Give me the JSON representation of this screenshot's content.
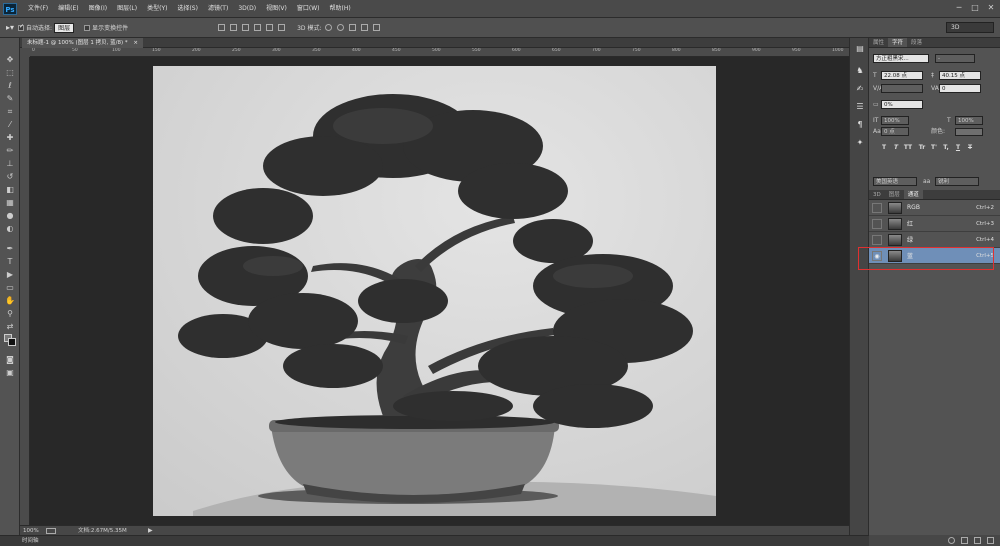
{
  "app": {
    "logo": "Ps",
    "workspace": "3D"
  },
  "menu": [
    "文件(F)",
    "编辑(E)",
    "图像(I)",
    "图层(L)",
    "类型(Y)",
    "选择(S)",
    "滤镜(T)",
    "3D(D)",
    "视图(V)",
    "窗口(W)",
    "帮助(H)"
  ],
  "window_controls": [
    "─",
    "□",
    "✕"
  ],
  "options": {
    "auto_select_label": "自动选择:",
    "auto_select_value": "图层",
    "show_transform_label": "显示变换控件",
    "mode_label": "3D 模式:"
  },
  "document": {
    "tab_title": "未标题-1 @ 100% (图层 1 拷贝, 蓝/8) *",
    "tab_close": "×",
    "ruler_ticks": [
      "0",
      "50",
      "100",
      "150",
      "200",
      "250",
      "300",
      "350",
      "400",
      "450",
      "500",
      "550",
      "600",
      "650",
      "700",
      "750",
      "800",
      "850",
      "900",
      "950",
      "1000",
      "1050"
    ]
  },
  "status": {
    "zoom": "100%",
    "doc_info": "文档:2.67M/5.35M",
    "timeline": "时间轴"
  },
  "panels": {
    "top_tabs": [
      "属性",
      "字符",
      "段落"
    ],
    "character": {
      "font_family": "方正粗黑宋...",
      "font_style": "-",
      "font_size": "22.08 点",
      "leading": "40.15 点",
      "kerning": "",
      "tracking": "0",
      "scale_percent": "0%",
      "vertical_scale": "100%",
      "horizontal_scale": "100%",
      "baseline_shift": "0 点",
      "color_label": "颜色:",
      "type_buttons": [
        "T",
        "T",
        "TT",
        "Tr",
        "T'",
        "T,",
        "T",
        "T"
      ],
      "language": "美国英语",
      "aa_label": "aa",
      "antialias": "锐利"
    },
    "layers_tabs": [
      "3D",
      "图层",
      "通道"
    ],
    "channels": [
      {
        "name": "RGB",
        "shortcut": "Ctrl+2",
        "visible": false,
        "selected": false
      },
      {
        "name": "红",
        "shortcut": "Ctrl+3",
        "visible": false,
        "selected": false
      },
      {
        "name": "绿",
        "shortcut": "Ctrl+4",
        "visible": false,
        "selected": false
      },
      {
        "name": "蓝",
        "shortcut": "Ctrl+5",
        "visible": true,
        "selected": true
      }
    ]
  }
}
